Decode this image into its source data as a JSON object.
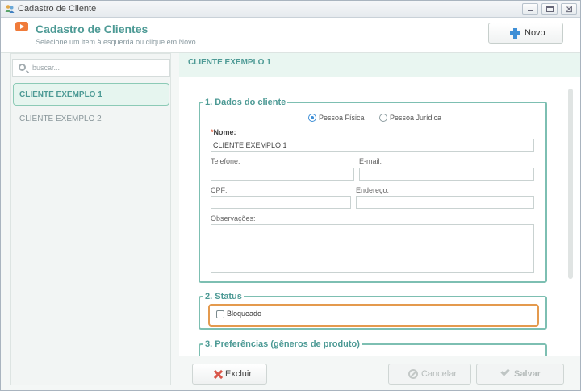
{
  "window": {
    "title": "Cadastro de Cliente",
    "minimize": "",
    "maximize": "",
    "close": "⊠"
  },
  "header": {
    "title": "Cadastro de Clientes",
    "subtitle": "Selecione um item à esquerda ou clique em Novo",
    "new_label": "Novo"
  },
  "sidebar": {
    "search_placeholder": "buscar...",
    "items": [
      {
        "label": "CLIENTE EXEMPLO 1",
        "selected": true
      },
      {
        "label": "CLIENTE EXEMPLO 2",
        "selected": false
      }
    ]
  },
  "client": {
    "title": "CLIENTE EXEMPLO 1",
    "section1": {
      "legend": "1. Dados do cliente",
      "person_type_options": [
        "Pessoa Física",
        "Pessoa Jurídica"
      ],
      "person_type_selected": "Pessoa Física",
      "name_required_mark": "*",
      "name_label": "Nome:",
      "name_value": "CLIENTE EXEMPLO 1",
      "phone_label": "Telefone:",
      "phone_value": "",
      "email_label": "E-mail:",
      "email_value": "",
      "cpf_label": "CPF:",
      "cpf_value": "",
      "address_label": "Endereço:",
      "address_value": "",
      "notes_label": "Observações:",
      "notes_value": ""
    },
    "section2": {
      "legend": "2. Status",
      "blocked_label": "Bloqueado",
      "blocked_checked": false
    },
    "section3": {
      "legend": "3. Preferências (gêneros de produto)"
    }
  },
  "actions": {
    "delete_label": "Excluir",
    "cancel_label": "Cancelar",
    "save_label": "Salvar"
  },
  "colors": {
    "accent": "#4d9a95",
    "section_border": "#7dbfb2",
    "status_highlight": "#e49a4e",
    "primary_icon": "#3f8fd6",
    "delete_icon": "#d8574a"
  }
}
